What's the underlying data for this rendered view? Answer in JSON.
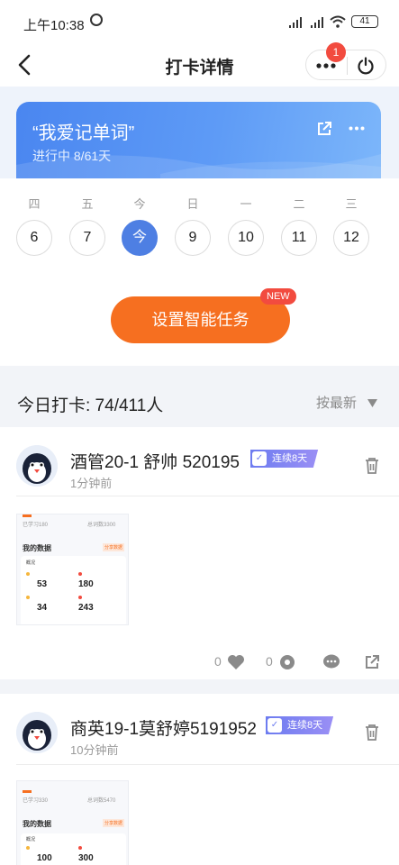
{
  "status": {
    "time": "上午10:38",
    "battery": "41"
  },
  "header": {
    "title": "打卡详情",
    "notification_count": "1"
  },
  "banner": {
    "title": "“我爱记单词”",
    "subtitle": "进行中 8/61天"
  },
  "calendar": {
    "weekdays": [
      "四",
      "五",
      "今",
      "日",
      "一",
      "二",
      "三"
    ],
    "days": [
      "6",
      "7",
      "今",
      "9",
      "10",
      "11",
      "12"
    ],
    "selected_index": 2
  },
  "smart_task": {
    "label": "设置智能任务",
    "new_tag": "NEW"
  },
  "today": {
    "label": "今日打卡: 74/411人",
    "sort": "按最新"
  },
  "posts": [
    {
      "name": "酒管20-1 舒帅 520195",
      "streak": "连续8天",
      "ago": "1分钟前",
      "likes": "0",
      "gifts": "0",
      "thumb": {
        "top": "已学习180",
        "top2": "总词数3300",
        "heading": "我的数据",
        "tag": "分享数据",
        "section": "概况",
        "n1": "53",
        "n2": "180",
        "n3": "34",
        "n4": "243"
      }
    },
    {
      "name": "商英19-1莫舒婷5191952",
      "streak": "连续8天",
      "ago": "10分钟前",
      "thumb": {
        "top": "已学习330",
        "top2": "总词数5470",
        "heading": "我的数据",
        "tag": "分享数据",
        "section": "概况",
        "n1": "100",
        "n2": "300"
      }
    }
  ],
  "colors": {
    "accent": "#4e7fe3",
    "orange": "#f66f20",
    "badge": "#f24b3f"
  }
}
